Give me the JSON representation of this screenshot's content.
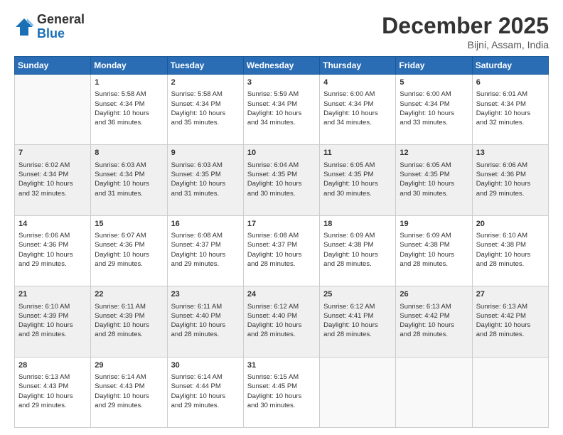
{
  "header": {
    "logo": {
      "general": "General",
      "blue": "Blue"
    },
    "title": "December 2025",
    "location": "Bijni, Assam, India"
  },
  "weekdays": [
    "Sunday",
    "Monday",
    "Tuesday",
    "Wednesday",
    "Thursday",
    "Friday",
    "Saturday"
  ],
  "weeks": [
    [
      {
        "day": "",
        "info": ""
      },
      {
        "day": "1",
        "info": "Sunrise: 5:58 AM\nSunset: 4:34 PM\nDaylight: 10 hours\nand 36 minutes."
      },
      {
        "day": "2",
        "info": "Sunrise: 5:58 AM\nSunset: 4:34 PM\nDaylight: 10 hours\nand 35 minutes."
      },
      {
        "day": "3",
        "info": "Sunrise: 5:59 AM\nSunset: 4:34 PM\nDaylight: 10 hours\nand 34 minutes."
      },
      {
        "day": "4",
        "info": "Sunrise: 6:00 AM\nSunset: 4:34 PM\nDaylight: 10 hours\nand 34 minutes."
      },
      {
        "day": "5",
        "info": "Sunrise: 6:00 AM\nSunset: 4:34 PM\nDaylight: 10 hours\nand 33 minutes."
      },
      {
        "day": "6",
        "info": "Sunrise: 6:01 AM\nSunset: 4:34 PM\nDaylight: 10 hours\nand 32 minutes."
      }
    ],
    [
      {
        "day": "7",
        "info": "Sunrise: 6:02 AM\nSunset: 4:34 PM\nDaylight: 10 hours\nand 32 minutes."
      },
      {
        "day": "8",
        "info": "Sunrise: 6:03 AM\nSunset: 4:34 PM\nDaylight: 10 hours\nand 31 minutes."
      },
      {
        "day": "9",
        "info": "Sunrise: 6:03 AM\nSunset: 4:35 PM\nDaylight: 10 hours\nand 31 minutes."
      },
      {
        "day": "10",
        "info": "Sunrise: 6:04 AM\nSunset: 4:35 PM\nDaylight: 10 hours\nand 30 minutes."
      },
      {
        "day": "11",
        "info": "Sunrise: 6:05 AM\nSunset: 4:35 PM\nDaylight: 10 hours\nand 30 minutes."
      },
      {
        "day": "12",
        "info": "Sunrise: 6:05 AM\nSunset: 4:35 PM\nDaylight: 10 hours\nand 30 minutes."
      },
      {
        "day": "13",
        "info": "Sunrise: 6:06 AM\nSunset: 4:36 PM\nDaylight: 10 hours\nand 29 minutes."
      }
    ],
    [
      {
        "day": "14",
        "info": "Sunrise: 6:06 AM\nSunset: 4:36 PM\nDaylight: 10 hours\nand 29 minutes."
      },
      {
        "day": "15",
        "info": "Sunrise: 6:07 AM\nSunset: 4:36 PM\nDaylight: 10 hours\nand 29 minutes."
      },
      {
        "day": "16",
        "info": "Sunrise: 6:08 AM\nSunset: 4:37 PM\nDaylight: 10 hours\nand 29 minutes."
      },
      {
        "day": "17",
        "info": "Sunrise: 6:08 AM\nSunset: 4:37 PM\nDaylight: 10 hours\nand 28 minutes."
      },
      {
        "day": "18",
        "info": "Sunrise: 6:09 AM\nSunset: 4:38 PM\nDaylight: 10 hours\nand 28 minutes."
      },
      {
        "day": "19",
        "info": "Sunrise: 6:09 AM\nSunset: 4:38 PM\nDaylight: 10 hours\nand 28 minutes."
      },
      {
        "day": "20",
        "info": "Sunrise: 6:10 AM\nSunset: 4:38 PM\nDaylight: 10 hours\nand 28 minutes."
      }
    ],
    [
      {
        "day": "21",
        "info": "Sunrise: 6:10 AM\nSunset: 4:39 PM\nDaylight: 10 hours\nand 28 minutes."
      },
      {
        "day": "22",
        "info": "Sunrise: 6:11 AM\nSunset: 4:39 PM\nDaylight: 10 hours\nand 28 minutes."
      },
      {
        "day": "23",
        "info": "Sunrise: 6:11 AM\nSunset: 4:40 PM\nDaylight: 10 hours\nand 28 minutes."
      },
      {
        "day": "24",
        "info": "Sunrise: 6:12 AM\nSunset: 4:40 PM\nDaylight: 10 hours\nand 28 minutes."
      },
      {
        "day": "25",
        "info": "Sunrise: 6:12 AM\nSunset: 4:41 PM\nDaylight: 10 hours\nand 28 minutes."
      },
      {
        "day": "26",
        "info": "Sunrise: 6:13 AM\nSunset: 4:42 PM\nDaylight: 10 hours\nand 28 minutes."
      },
      {
        "day": "27",
        "info": "Sunrise: 6:13 AM\nSunset: 4:42 PM\nDaylight: 10 hours\nand 28 minutes."
      }
    ],
    [
      {
        "day": "28",
        "info": "Sunrise: 6:13 AM\nSunset: 4:43 PM\nDaylight: 10 hours\nand 29 minutes."
      },
      {
        "day": "29",
        "info": "Sunrise: 6:14 AM\nSunset: 4:43 PM\nDaylight: 10 hours\nand 29 minutes."
      },
      {
        "day": "30",
        "info": "Sunrise: 6:14 AM\nSunset: 4:44 PM\nDaylight: 10 hours\nand 29 minutes."
      },
      {
        "day": "31",
        "info": "Sunrise: 6:15 AM\nSunset: 4:45 PM\nDaylight: 10 hours\nand 30 minutes."
      },
      {
        "day": "",
        "info": ""
      },
      {
        "day": "",
        "info": ""
      },
      {
        "day": "",
        "info": ""
      }
    ]
  ]
}
